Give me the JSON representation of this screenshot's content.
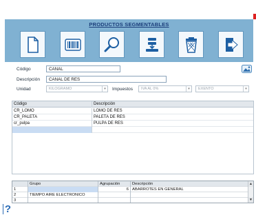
{
  "title": "PRODUCTOS SEGMENTABLES",
  "toolbar": [
    {
      "name": "new-document-icon"
    },
    {
      "name": "barcode-icon"
    },
    {
      "name": "search-icon"
    },
    {
      "name": "save-stack-icon"
    },
    {
      "name": "recycle-bin-icon"
    },
    {
      "name": "exit-icon"
    }
  ],
  "form": {
    "codigo_label": "Código",
    "codigo_value": "CANAL",
    "descripcion_label": "Descripción",
    "descripcion_value": "CANAL DE RES",
    "unidad_label": "Unidad",
    "unidad_value": "KILOGRAMO",
    "impuestos_label": "Impuestos",
    "impuestos_value": "IVA AL 0%",
    "exento_value": "EXENTO"
  },
  "grid1": {
    "headers": [
      "Código",
      "Descripción"
    ],
    "rows": [
      [
        "CR_LOMO",
        "LOMO DE RES"
      ],
      [
        "CR_PALETA",
        "PALETA DE RES"
      ],
      [
        "cr_pulpa",
        "PULPA DE RES"
      ]
    ]
  },
  "grid2": {
    "headers": [
      "Grupo",
      "Agrupación",
      "Descripción"
    ],
    "rows": [
      [
        "1",
        "",
        "6",
        "ABARROTES EN GENERAL"
      ],
      [
        "2",
        "TIEMPO AIRE ELECTRONICO",
        "",
        ""
      ],
      [
        "3",
        "",
        "",
        ""
      ]
    ]
  },
  "colors": {
    "panel": "#80b1d2",
    "title": "#1a3d7a",
    "selected": "#c9dcf3"
  }
}
